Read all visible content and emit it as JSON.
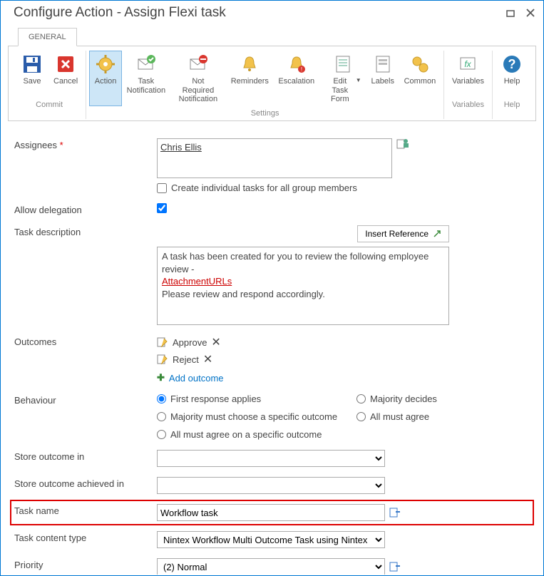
{
  "window": {
    "title": "Configure Action - Assign Flexi task"
  },
  "tabs": {
    "general": "GENERAL"
  },
  "ribbon": {
    "commit_label": "Commit",
    "settings_label": "Settings",
    "variables_label": "Variables",
    "help_label": "Help",
    "buttons": {
      "save": "Save",
      "cancel": "Cancel",
      "action": "Action",
      "task_notification": "Task\nNotification",
      "not_required_notification": "Not Required\nNotification",
      "reminders": "Reminders",
      "escalation": "Escalation",
      "edit_task_form": "Edit Task\nForm",
      "labels": "Labels",
      "common": "Common",
      "variables": "Variables",
      "help": "Help"
    }
  },
  "form": {
    "assignees_label": "Assignees",
    "assignees_value": "Chris Ellis",
    "create_individual_label": "Create individual tasks for all group members",
    "create_individual_checked": false,
    "allow_delegation_label": "Allow delegation",
    "allow_delegation_checked": true,
    "task_description_label": "Task description",
    "insert_reference_label": "Insert Reference",
    "task_description_line1": "A task has been created for you to review the following employee review -",
    "task_description_link": "AttachmentURLs",
    "task_description_line2": "Please review and respond accordingly.",
    "outcomes_label": "Outcomes",
    "outcomes": [
      "Approve",
      "Reject"
    ],
    "add_outcome_label": "Add outcome",
    "behaviour_label": "Behaviour",
    "behaviour_options": {
      "first_response": "First response applies",
      "majority_decides": "Majority decides",
      "majority_specific": "Majority must choose a specific outcome",
      "all_agree": "All must agree",
      "all_agree_specific": "All must agree on a specific outcome"
    },
    "behaviour_selected": "first_response",
    "store_outcome_in_label": "Store outcome in",
    "store_outcome_in_value": "",
    "store_outcome_achieved_label": "Store outcome achieved in",
    "store_outcome_achieved_value": "",
    "task_name_label": "Task name",
    "task_name_value": "Workflow task",
    "task_content_type_label": "Task content type",
    "task_content_type_value": "Nintex Workflow Multi Outcome Task using Nintex For",
    "priority_label": "Priority",
    "priority_value": "(2) Normal"
  }
}
